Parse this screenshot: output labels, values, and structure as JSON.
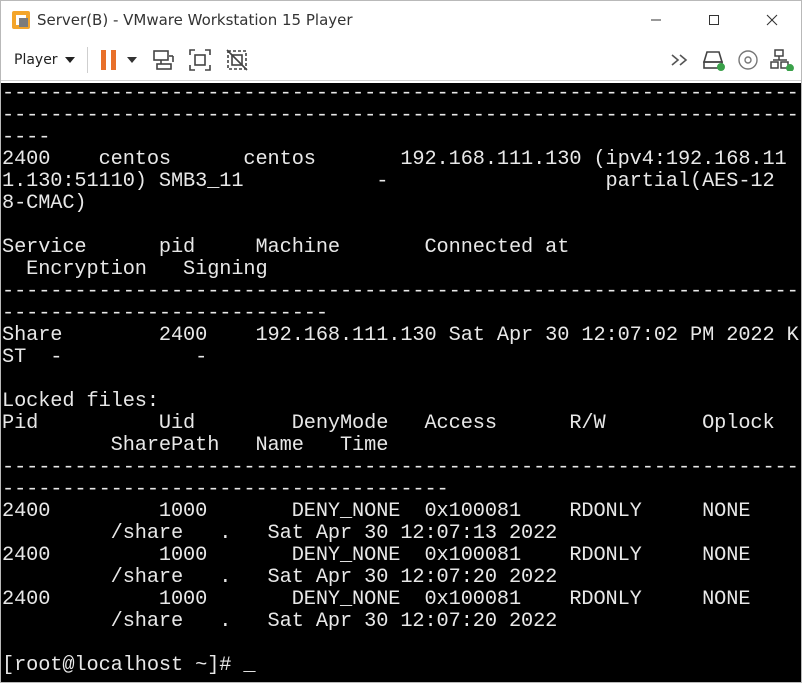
{
  "window": {
    "title": "Server(B) - VMware Workstation 15 Player",
    "app_icon": "vmware-icon",
    "controls": [
      "minimize-icon",
      "maximize-icon",
      "close-icon"
    ]
  },
  "toolbar": {
    "player_label": "Player",
    "left_icons": [
      "pause-icon",
      "dropdown-caret-icon",
      "send-ctrl-alt-del-icon",
      "fit-guest-icon",
      "unity-icon"
    ],
    "right_icons": [
      "double-chevron-icon",
      "hard-disk-icon",
      "cd-dvd-icon",
      "network-icon"
    ]
  },
  "colors": {
    "console_bg": "#000000",
    "console_fg": "#e8e8e8",
    "pause_orange": "#e8702a"
  },
  "console": {
    "lines": [
      "-------------------------------------------------------------------",
      "-------------------------------------------------------------------",
      "----",
      "2400    centos      centos       192.168.111.130 (ipv4:192.168.11",
      "1.130:51110) SMB3_11           -                  partial(AES-12",
      "8-CMAC)",
      "",
      "Service      pid     Machine       Connected at",
      "  Encryption   Signing",
      "-------------------------------------------------------------------",
      "---------------------------",
      "Share        2400    192.168.111.130 Sat Apr 30 12:07:02 PM 2022 K",
      "ST  -           -",
      "",
      "Locked files:",
      "Pid          Uid        DenyMode   Access      R/W        Oplock",
      "         SharePath   Name   Time",
      "-------------------------------------------------------------------",
      "-------------------------------------",
      "2400         1000       DENY_NONE  0x100081    RDONLY     NONE",
      "         /share   .   Sat Apr 30 12:07:13 2022",
      "2400         1000       DENY_NONE  0x100081    RDONLY     NONE",
      "         /share   .   Sat Apr 30 12:07:20 2022",
      "2400         1000       DENY_NONE  0x100081    RDONLY     NONE",
      "         /share   .   Sat Apr 30 12:07:20 2022",
      "",
      "[root@localhost ~]# _"
    ]
  }
}
